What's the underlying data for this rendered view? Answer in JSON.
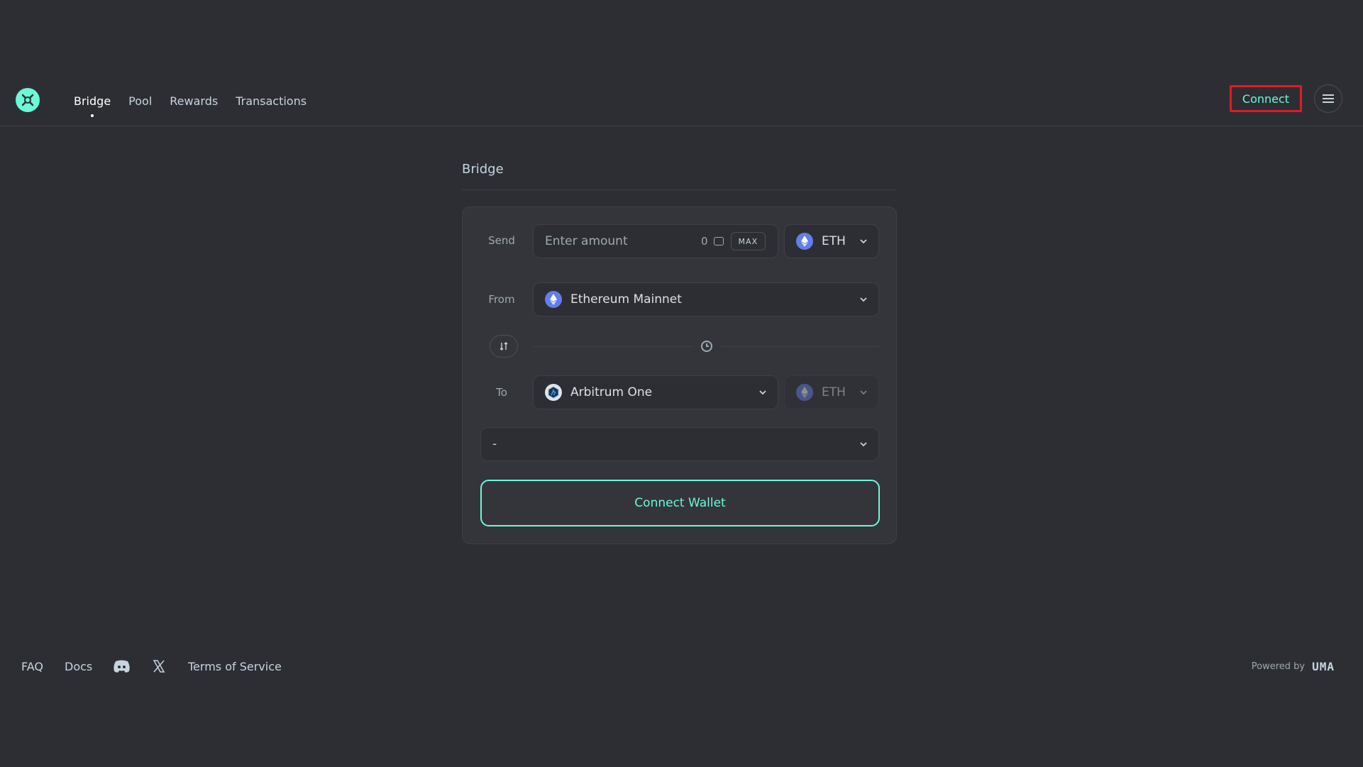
{
  "header": {
    "nav": [
      "Bridge",
      "Pool",
      "Rewards",
      "Transactions"
    ],
    "active_nav": "Bridge",
    "connect_label": "Connect"
  },
  "page": {
    "title": "Bridge"
  },
  "form": {
    "send_label": "Send",
    "amount_placeholder": "Enter amount",
    "balance": "0",
    "max_label": "MAX",
    "send_token": "ETH",
    "from_label": "From",
    "from_chain": "Ethereum Mainnet",
    "to_label": "To",
    "to_chain": "Arbitrum One",
    "to_token": "ETH",
    "route_select": "-",
    "connect_wallet_label": "Connect Wallet"
  },
  "footer": {
    "links": [
      "FAQ",
      "Docs",
      "Terms of Service"
    ],
    "powered_by": "Powered by",
    "powered_brand": "UMA"
  },
  "colors": {
    "background": "#2d2e33",
    "accent": "#6cf9d8",
    "highlight_border": "#e01b24"
  }
}
